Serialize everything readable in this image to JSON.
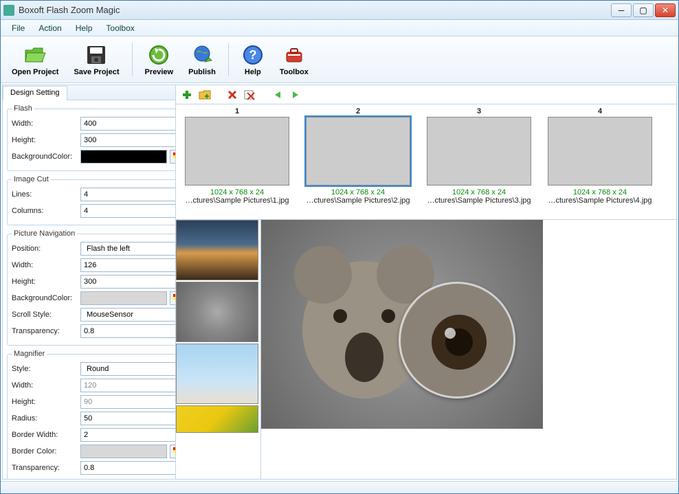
{
  "app": {
    "title": "Boxoft Flash Zoom Magic"
  },
  "menu": [
    "File",
    "Action",
    "Help",
    "Toolbox"
  ],
  "toolbar": [
    {
      "label": "Open Project",
      "icon": "folder-open"
    },
    {
      "label": "Save Project",
      "icon": "floppy"
    },
    {
      "label": "Preview",
      "icon": "refresh"
    },
    {
      "label": "Publish",
      "icon": "globe"
    },
    {
      "label": "Help",
      "icon": "help"
    },
    {
      "label": "Toolbox",
      "icon": "toolbox"
    }
  ],
  "tab": "Design Setting",
  "flash": {
    "legend": "Flash",
    "width_label": "Width:",
    "width": "400",
    "height_label": "Height:",
    "height": "300",
    "bgcolor_label": "BackgroundColor:",
    "bgcolor": "#000000"
  },
  "imagecut": {
    "legend": "Image Cut",
    "lines_label": "Lines:",
    "lines": "4",
    "columns_label": "Columns:",
    "columns": "4"
  },
  "picnav": {
    "legend": "Picture Navigation",
    "position_label": "Position:",
    "position": "Flash the left",
    "width_label": "Width:",
    "width": "126",
    "height_label": "Height:",
    "height": "300",
    "bgcolor_label": "BackgroundColor:",
    "bgcolor": "#d8d8d8",
    "scrollstyle_label": "Scroll Style:",
    "scrollstyle": "MouseSensor",
    "transparency_label": "Transparency:",
    "transparency": "0.8"
  },
  "magnifier": {
    "legend": "Magnifier",
    "style_label": "Style:",
    "style": "Round",
    "width_label": "Width:",
    "width": "120",
    "height_label": "Height:",
    "height": "90",
    "radius_label": "Radius:",
    "radius": "50",
    "borderwidth_label": "Border Width:",
    "borderwidth": "2",
    "bordercolor_label": "Border Color:",
    "bordercolor": "#d8d8d8",
    "transparency_label": "Transparency:",
    "transparency": "0.8"
  },
  "thumbs": [
    {
      "num": "1",
      "dim": "1024 x 768 x 24",
      "path": "…ctures\\Sample Pictures\\1.jpg",
      "cls": "lighthouse"
    },
    {
      "num": "2",
      "dim": "1024 x 768 x 24",
      "path": "…ctures\\Sample Pictures\\2.jpg",
      "cls": "koala",
      "selected": true
    },
    {
      "num": "3",
      "dim": "1024 x 768 x 24",
      "path": "…ctures\\Sample Pictures\\3.jpg",
      "cls": "penguins"
    },
    {
      "num": "4",
      "dim": "1024 x 768 x 24",
      "path": "…ctures\\Sample Pictures\\4.jpg",
      "cls": "tulips"
    }
  ]
}
